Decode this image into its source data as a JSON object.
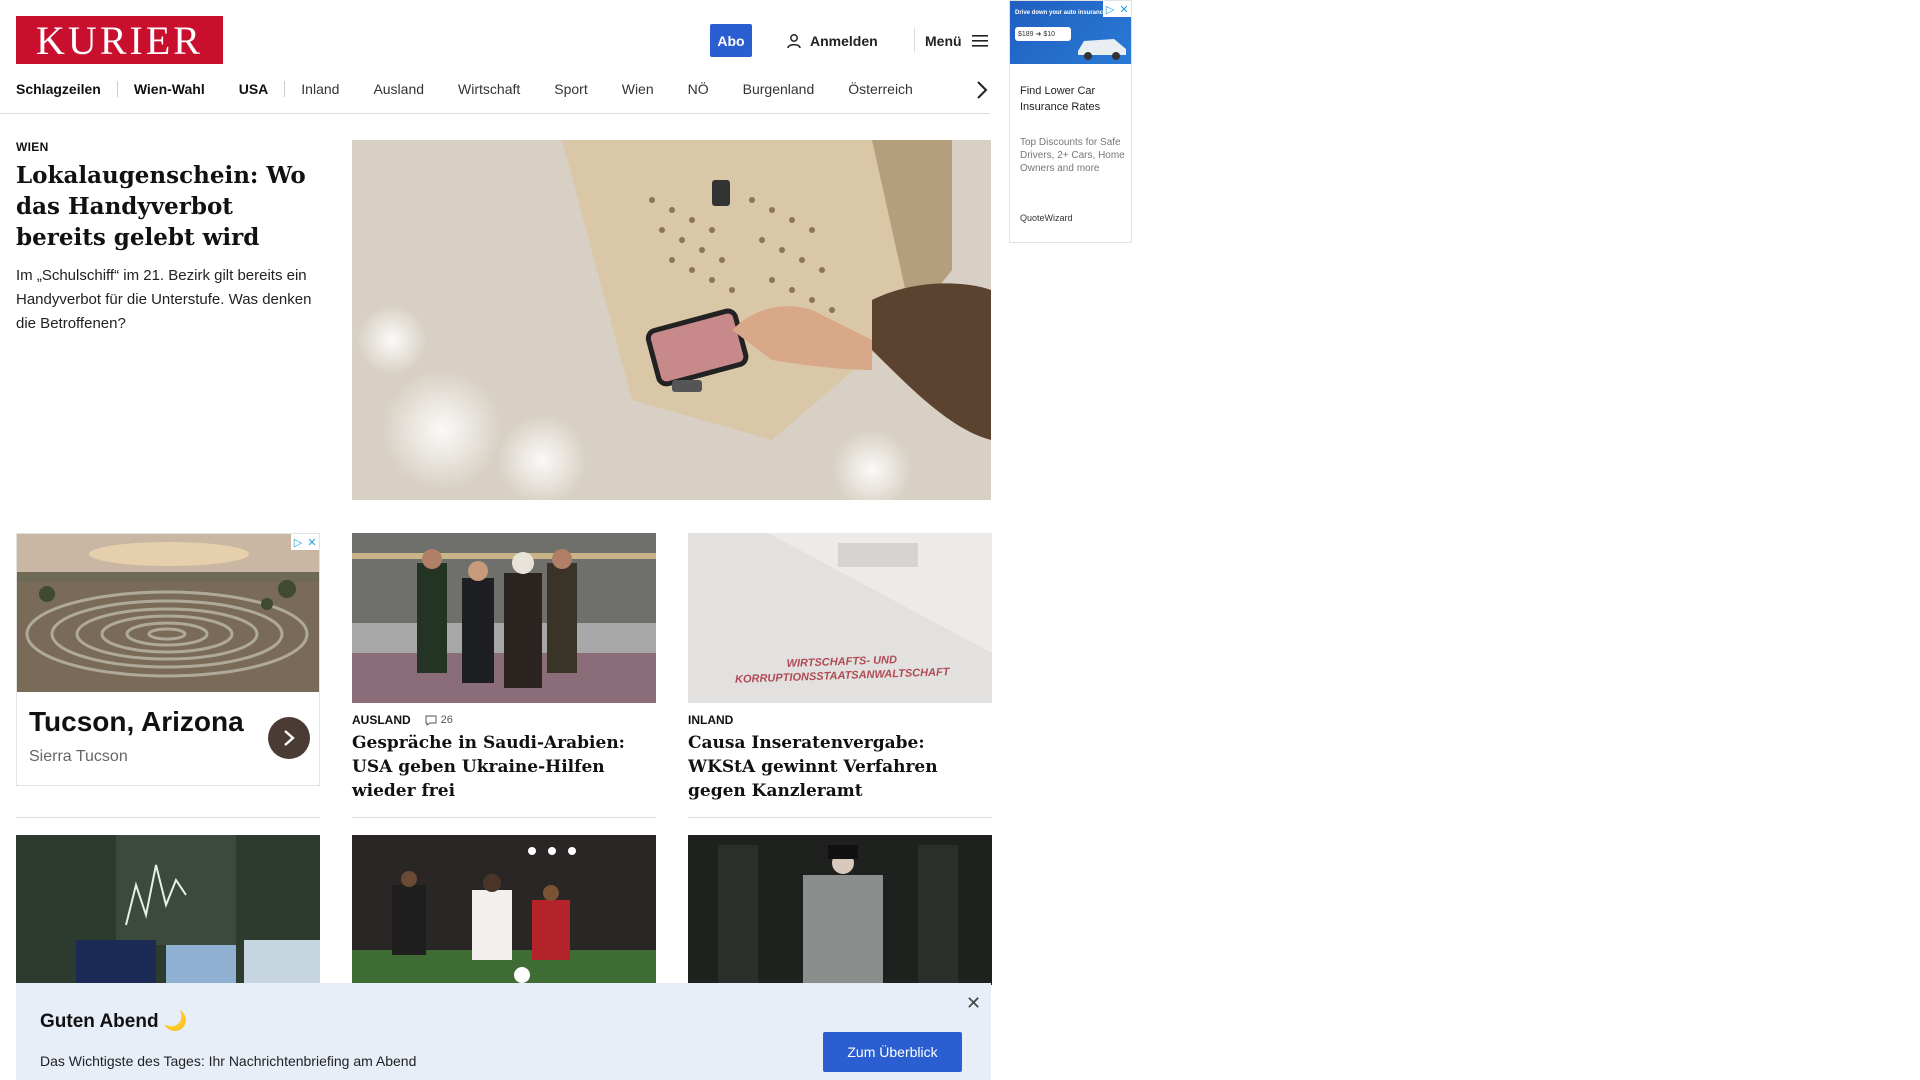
{
  "header": {
    "logo": "KURIER",
    "abo_label": "Abo",
    "login_label": "Anmelden",
    "menu_label": "Menü"
  },
  "nav": {
    "items": [
      "Schlagzeilen",
      "Wien-Wahl",
      "USA",
      "Inland",
      "Ausland",
      "Wirtschaft",
      "Sport",
      "Wien",
      "NÖ",
      "Burgenland",
      "Österreich"
    ]
  },
  "lead": {
    "kicker": "WIEN",
    "title": "Lokalaugenschein: Wo das Handyverbot bereits gelebt wird",
    "teaser": "Im „Schulschiff“ im 21. Bezirk gilt bereits ein Handyverbot für die Unterstufe. Was denken die Betroffenen?"
  },
  "ad_left": {
    "title": "Tucson, Arizona",
    "subtitle": "Sierra Tucson"
  },
  "cards": [
    {
      "kicker": "AUSLAND",
      "comments": "26",
      "title": "Gespräche in Saudi-Arabien: USA geben Ukraine-Hilfen wieder frei"
    },
    {
      "kicker": "INLAND",
      "title": "Causa Inseratenvergabe: WKStA gewinnt Verfahren gegen Kanzleramt",
      "image_text": "WIRTSCHAFTS- UND KORRUPTIONSSTAATSANWALTSCHAFT"
    }
  ],
  "ad_right": {
    "banner_text": "Drive down your auto insurance",
    "price_pill": "$189 ➜ $10",
    "headline": "Find Lower Car Insurance Rates",
    "body": "Top Discounts for Safe Drivers, 2+ Cars, Home Owners and more",
    "brand": "QuoteWizard"
  },
  "briefing": {
    "title": "Guten Abend 🌙",
    "text": "Das Wichtigste des Tages: Ihr Nachrichtenbriefing am Abend",
    "button": "Zum Überblick"
  },
  "colors": {
    "brand_red": "#c8102e",
    "accent_blue": "#2b5fd1",
    "briefing_bg": "#e8eef8"
  }
}
